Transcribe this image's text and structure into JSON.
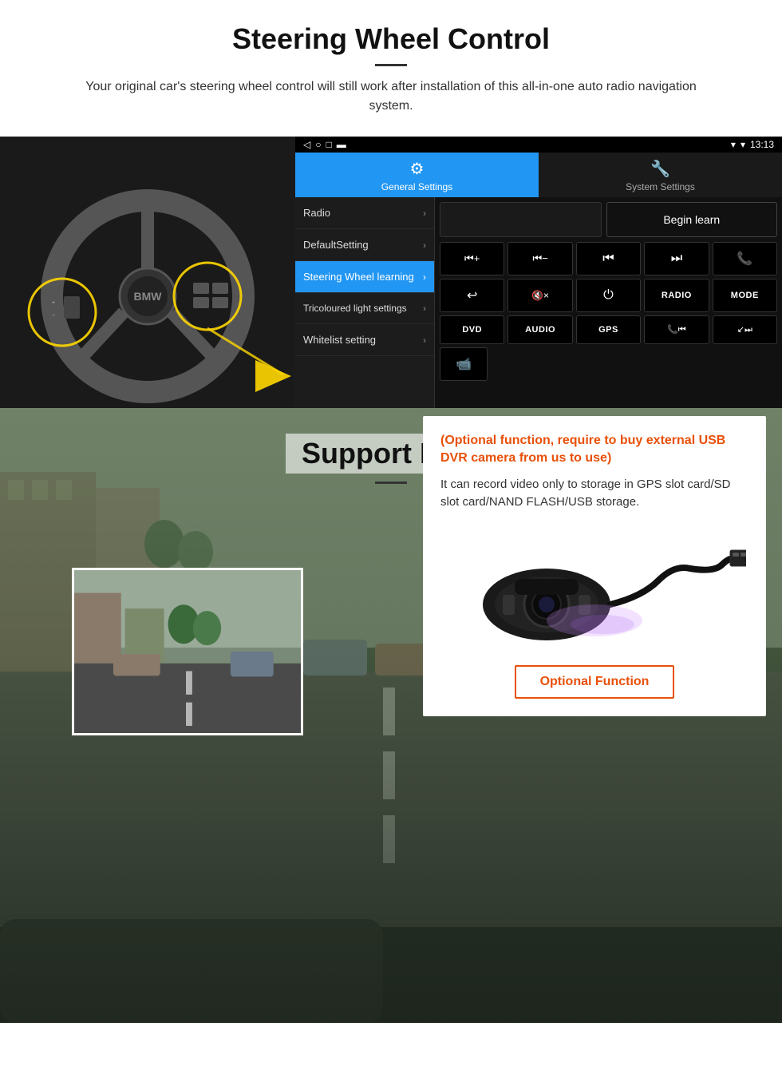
{
  "steering_section": {
    "title": "Steering Wheel Control",
    "subtitle": "Your original car's steering wheel control will still work after installation of this all-in-one auto radio navigation system.",
    "statusbar": {
      "signal": "▾",
      "wifi": "▾",
      "time": "13:13"
    },
    "tabs": {
      "general": "General Settings",
      "system": "System Settings"
    },
    "menu_items": [
      {
        "label": "Radio",
        "active": false
      },
      {
        "label": "DefaultSetting",
        "active": false
      },
      {
        "label": "Steering Wheel learning",
        "active": true
      },
      {
        "label": "Tricoloured light settings",
        "active": false
      },
      {
        "label": "Whitelist setting",
        "active": false
      }
    ],
    "begin_learn_btn": "Begin learn",
    "control_buttons": [
      {
        "icon": "⏮+",
        "type": "icon"
      },
      {
        "icon": "⏮−",
        "type": "icon"
      },
      {
        "icon": "⏮",
        "type": "icon"
      },
      {
        "icon": "⏭",
        "type": "icon"
      },
      {
        "icon": "📞",
        "type": "icon"
      },
      {
        "icon": "↩",
        "type": "icon"
      },
      {
        "icon": "🔇×",
        "type": "icon"
      },
      {
        "icon": "⏻",
        "type": "icon"
      },
      {
        "icon": "RADIO",
        "type": "text"
      },
      {
        "icon": "MODE",
        "type": "text"
      },
      {
        "icon": "DVD",
        "type": "text"
      },
      {
        "icon": "AUDIO",
        "type": "text"
      },
      {
        "icon": "GPS",
        "type": "text"
      },
      {
        "icon": "📞⏮",
        "type": "icon"
      },
      {
        "icon": "↙⏭",
        "type": "icon"
      }
    ]
  },
  "dvr_section": {
    "title": "Support DVR",
    "optional_text": "(Optional function, require to buy external USB DVR camera from us to use)",
    "description": "It can record video only to storage in GPS slot card/SD slot card/NAND FLASH/USB storage.",
    "optional_function_btn": "Optional Function"
  }
}
